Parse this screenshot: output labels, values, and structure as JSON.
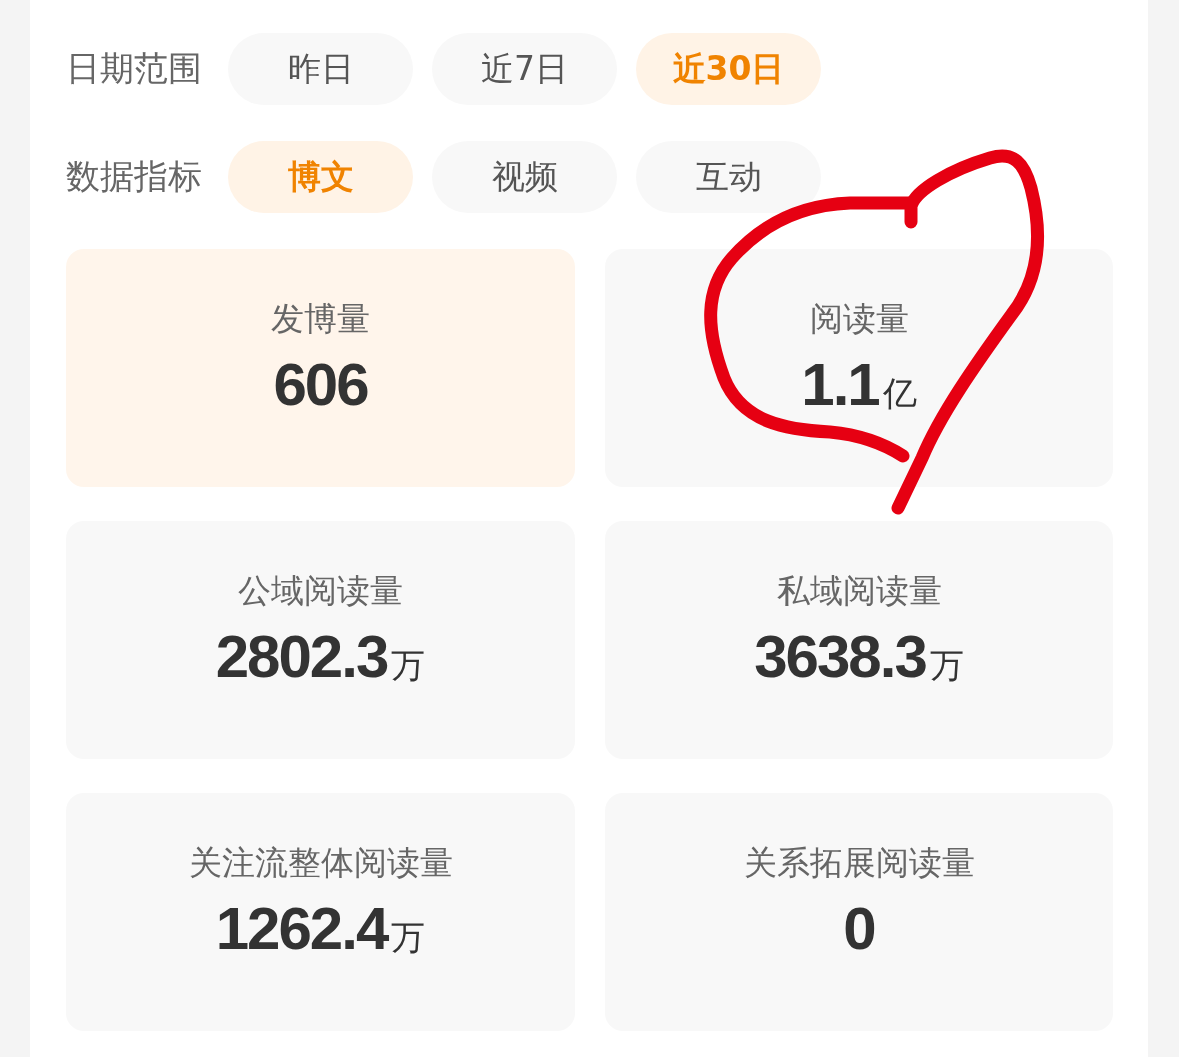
{
  "filters": [
    {
      "label": "日期范围",
      "options": [
        {
          "label": "昨日",
          "selected": false
        },
        {
          "label": "近7日",
          "selected": false
        },
        {
          "label": "近30日",
          "selected": true
        }
      ]
    },
    {
      "label": "数据指标",
      "options": [
        {
          "label": "博文",
          "selected": true
        },
        {
          "label": "视频",
          "selected": false
        },
        {
          "label": "互动",
          "selected": false
        }
      ]
    }
  ],
  "metrics": [
    {
      "label": "发博量",
      "value": "606",
      "selected": true
    },
    {
      "label": "阅读量",
      "value": "1.1",
      "unit": "亿",
      "selected": false
    },
    {
      "label": "公域阅读量",
      "value": "2802.3",
      "unit": "万",
      "selected": false
    },
    {
      "label": "私域阅读量",
      "value": "3638.3",
      "unit": "万",
      "selected": false
    },
    {
      "label": "关注流整体阅读量",
      "value": "1262.4",
      "unit": "万",
      "selected": false
    },
    {
      "label": "关系拓展阅读量",
      "value": "0",
      "selected": false
    }
  ],
  "annotation": {
    "kind": "heart"
  }
}
